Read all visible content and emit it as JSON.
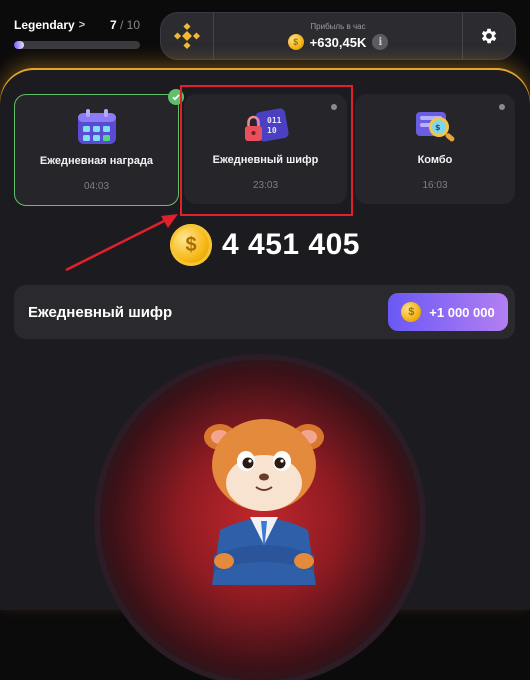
{
  "header": {
    "level_name": "Legendary",
    "level_current": "7",
    "level_total": "/ 10",
    "level_progress_percent": 8,
    "profit_label": "Прибыль в час",
    "profit_value": "+630,45K",
    "info_label": "i"
  },
  "cards": [
    {
      "title": "Ежедневная награда",
      "timer": "04:03",
      "icon": "calendar-icon",
      "completed": true
    },
    {
      "title": "Ежедневный шифр",
      "timer": "23:03",
      "icon": "cipher-lock-icon",
      "completed": false
    },
    {
      "title": "Комбо",
      "timer": "16:03",
      "icon": "combo-magnifier-icon",
      "completed": false
    }
  ],
  "balance": {
    "value": "4 451 405"
  },
  "cipher": {
    "label": "Ежедневный шифр",
    "reward": "+1 000 000"
  },
  "colors": {
    "accent_purple": "#7b5cff",
    "gold": "#f5b50f",
    "annotation_red": "#e0202a",
    "completed_green": "#5fbf6a"
  }
}
